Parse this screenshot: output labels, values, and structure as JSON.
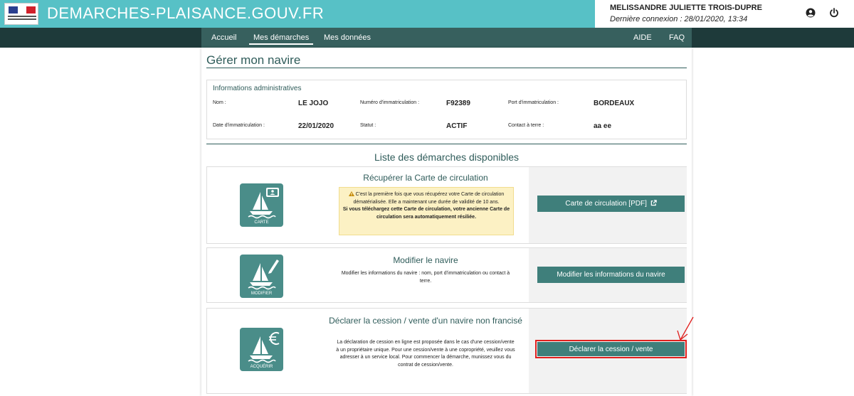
{
  "header": {
    "site_title": "DEMARCHES-PLAISANCE.GOUV.FR",
    "user_name": "MELISSANDRE JULIETTE TROIS-DUPRE",
    "last_login": "Dernière connexion : 28/01/2020, 13:34",
    "brand_color": "#57c1c6"
  },
  "nav": {
    "items": [
      "Accueil",
      "Mes démarches",
      "Mes données"
    ],
    "active": "Mes démarches",
    "right_items": [
      "AIDE",
      "FAQ"
    ]
  },
  "page": {
    "title": "Gérer mon navire"
  },
  "info": {
    "heading": "Informations administratives",
    "fields": [
      {
        "label": "Nom :",
        "value": "LE JOJO"
      },
      {
        "label": "Numéro d'immatriculation :",
        "value": "F92389"
      },
      {
        "label": "Port d'immatriculation :",
        "value": "BORDEAUX"
      },
      {
        "label": "Date d'immatriculation :",
        "value": "22/01/2020"
      },
      {
        "label": "Statut :",
        "value": "ACTIF"
      },
      {
        "label": "Contact à terre :",
        "value": "aa ee"
      }
    ]
  },
  "list_title": "Liste des démarches disponibles",
  "cards": [
    {
      "icon_caption": "CARTE",
      "title": "Récupérer la Carte de circulation",
      "warning_text": "C'est la première fois que vous récupérez votre Carte de circulation dématérialisée. Elle a maintenant une durée de validité de 10 ans.",
      "warning_bold": "Si vous téléchargez cette Carte de circulation, votre ancienne Carte de circulation sera automatiquement résiliée.",
      "button": "Carte de circulation [PDF]"
    },
    {
      "icon_caption": "MODIFIER",
      "title": "Modifier le navire",
      "description": "Modifier les informations du navire : nom, port d'immatriculation ou contact à terre.",
      "button": "Modifier les informations du navire"
    },
    {
      "icon_caption": "ACQUÉRIR",
      "title": "Déclarer la cession / vente d'un navire non francisé",
      "description": "La déclaration de cession en ligne est proposée dans le cas d'une cession/vente à un propriétaire unique. Pour une cession/vente à une copropriété, veuillez vous adresser à un service local. Pour commencer la démarche, munissez vous du contrat de cession/vente.",
      "button": "Déclarer la cession / vente"
    }
  ]
}
